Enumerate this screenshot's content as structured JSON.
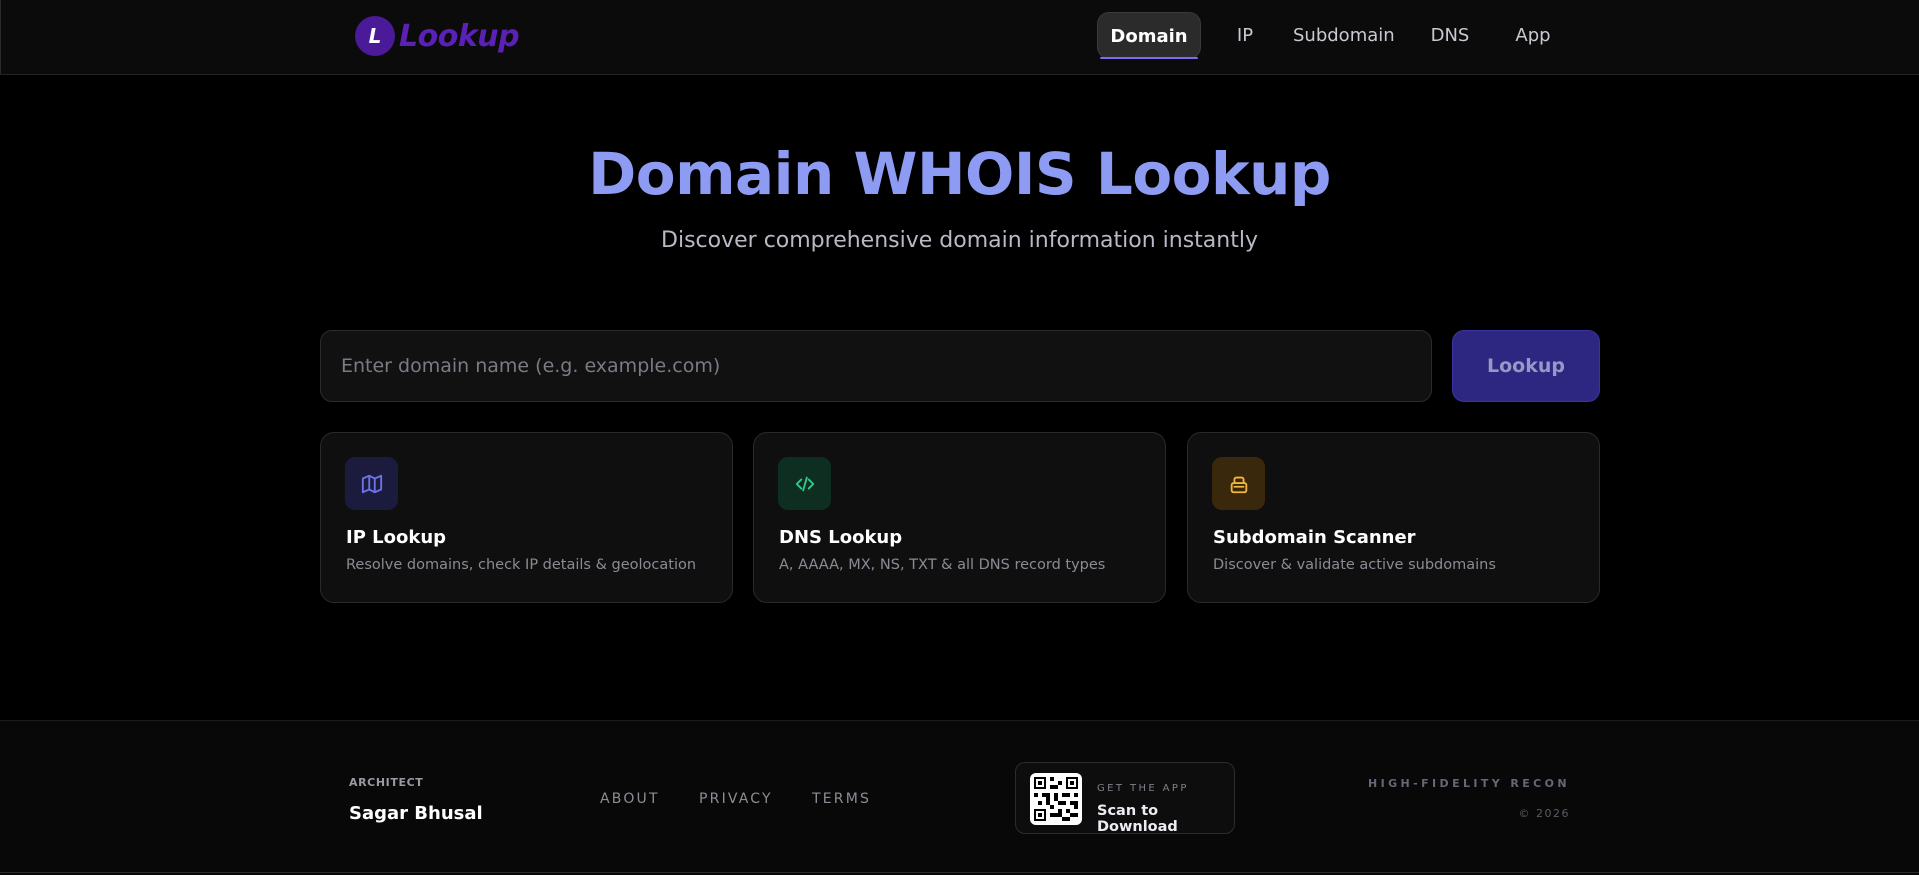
{
  "brand": {
    "logo_letter": "L",
    "name": "Lookup"
  },
  "nav": {
    "items": [
      {
        "label": "Domain",
        "active": true
      },
      {
        "label": "IP"
      },
      {
        "label": "Subdomain"
      },
      {
        "label": "DNS"
      },
      {
        "label": "App"
      }
    ]
  },
  "hero": {
    "title": "Domain WHOIS Lookup",
    "subtitle": "Discover comprehensive domain information instantly"
  },
  "search": {
    "placeholder": "Enter domain name (e.g. example.com)",
    "value": "",
    "button_label": "Lookup"
  },
  "cards": [
    {
      "icon": "map-icon",
      "title": "IP Lookup",
      "description": "Resolve domains, check IP details & geolocation",
      "accent": "#6d73e8"
    },
    {
      "icon": "code-icon",
      "title": "DNS Lookup",
      "description": "A, AAAA, MX, NS, TXT & all DNS record types",
      "accent": "#2ecc8f"
    },
    {
      "icon": "archive-icon",
      "title": "Subdomain Scanner",
      "description": "Discover & validate active subdomains",
      "accent": "#f4b73e"
    }
  ],
  "footer": {
    "architect_label": "ARCHITECT",
    "architect_name": "Sagar Bhusal",
    "links": [
      "ABOUT",
      "PRIVACY",
      "TERMS"
    ],
    "app_label": "GET THE APP",
    "app_title": "Scan to Download",
    "tagline": "HIGH-FIDELITY RECON",
    "copyright": "© 2026"
  },
  "colors": {
    "accent_primary": "#8e9bf3",
    "brand_purple": "#5b21b6",
    "button_bg": "#2d2781",
    "nav_underline": "#7c6cf2"
  }
}
